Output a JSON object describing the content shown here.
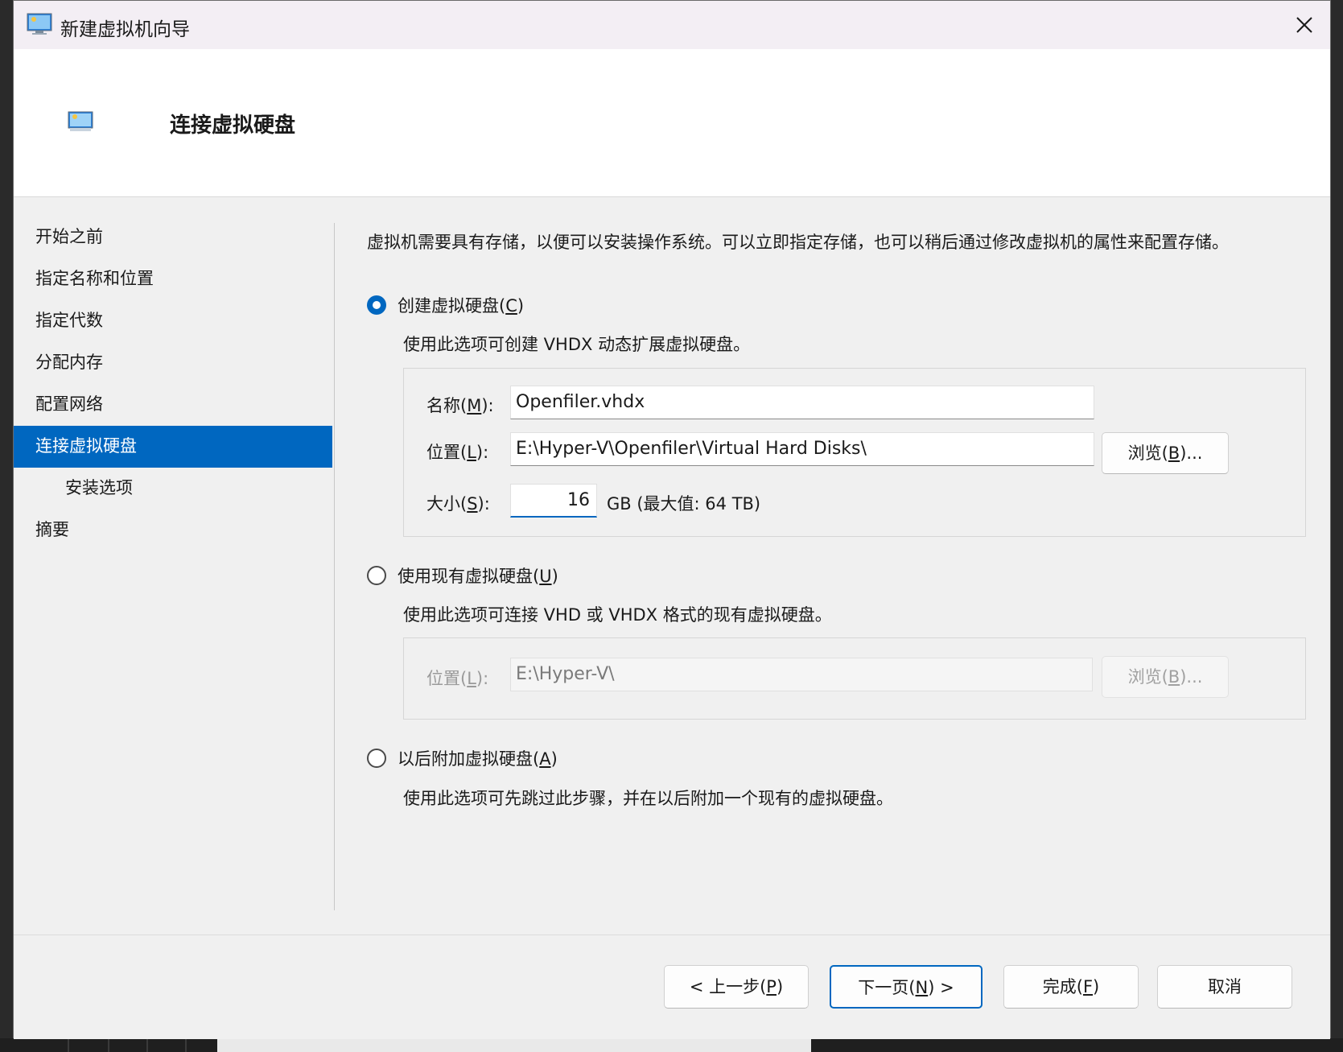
{
  "window": {
    "title": "新建虚拟机向导",
    "close_label": "×"
  },
  "header": {
    "title": "连接虚拟硬盘"
  },
  "nav": {
    "items": [
      {
        "label": "开始之前"
      },
      {
        "label": "指定名称和位置"
      },
      {
        "label": "指定代数"
      },
      {
        "label": "分配内存"
      },
      {
        "label": "配置网络"
      },
      {
        "label": "连接虚拟硬盘"
      },
      {
        "label": "安装选项"
      },
      {
        "label": "摘要"
      }
    ],
    "active_index": 5
  },
  "content": {
    "intro": "虚拟机需要具有存储，以便可以安装操作系统。可以立即指定存储，也可以稍后通过修改虚拟机的属性来配置存储。",
    "create": {
      "label_pre": "创建虚拟硬盘(",
      "accel": "C",
      "label_post": ")",
      "checked": true,
      "description": "使用此选项可创建 VHDX 动态扩展虚拟硬盘。",
      "name_label_pre": "名称(",
      "name_accel": "M",
      "name_label_post": "):",
      "name_value": "Openfiler.vhdx",
      "location_label_pre": "位置(",
      "location_accel": "L",
      "location_label_post": "):",
      "location_value": "E:\\Hyper-V\\Openfiler\\Virtual Hard Disks\\",
      "browse_pre": "浏览(",
      "browse_accel": "B",
      "browse_post": ")...",
      "size_label_pre": "大小(",
      "size_accel": "S",
      "size_label_post": "):",
      "size_value": "16",
      "size_unit": "GB (最大值: 64 TB)"
    },
    "existing": {
      "label_pre": "使用现有虚拟硬盘(",
      "accel": "U",
      "label_post": ")",
      "checked": false,
      "description": "使用此选项可连接 VHD 或 VHDX 格式的现有虚拟硬盘。",
      "location_label_pre": "位置(",
      "location_accel": "L",
      "location_label_post": "):",
      "location_value": "E:\\Hyper-V\\",
      "browse_pre": "浏览(",
      "browse_accel": "B",
      "browse_post": ")..."
    },
    "later": {
      "label_pre": "以后附加虚拟硬盘(",
      "accel": "A",
      "label_post": ")",
      "checked": false,
      "description": "使用此选项可先跳过此步骤，并在以后附加一个现有的虚拟硬盘。"
    }
  },
  "footer": {
    "prev_pre": "< 上一步(",
    "prev_accel": "P",
    "prev_post": ")",
    "next_pre": "下一页(",
    "next_accel": "N",
    "next_post": ") >",
    "finish_pre": "完成(",
    "finish_accel": "F",
    "finish_post": ")",
    "cancel": "取消"
  },
  "colors": {
    "accent": "#0067c0",
    "titlebar": "#f3eef4",
    "window_bg": "#f0f0f0"
  },
  "icons": [
    "monitor-icon",
    "close-icon",
    "radio-checked-icon",
    "radio-unchecked-icon"
  ]
}
